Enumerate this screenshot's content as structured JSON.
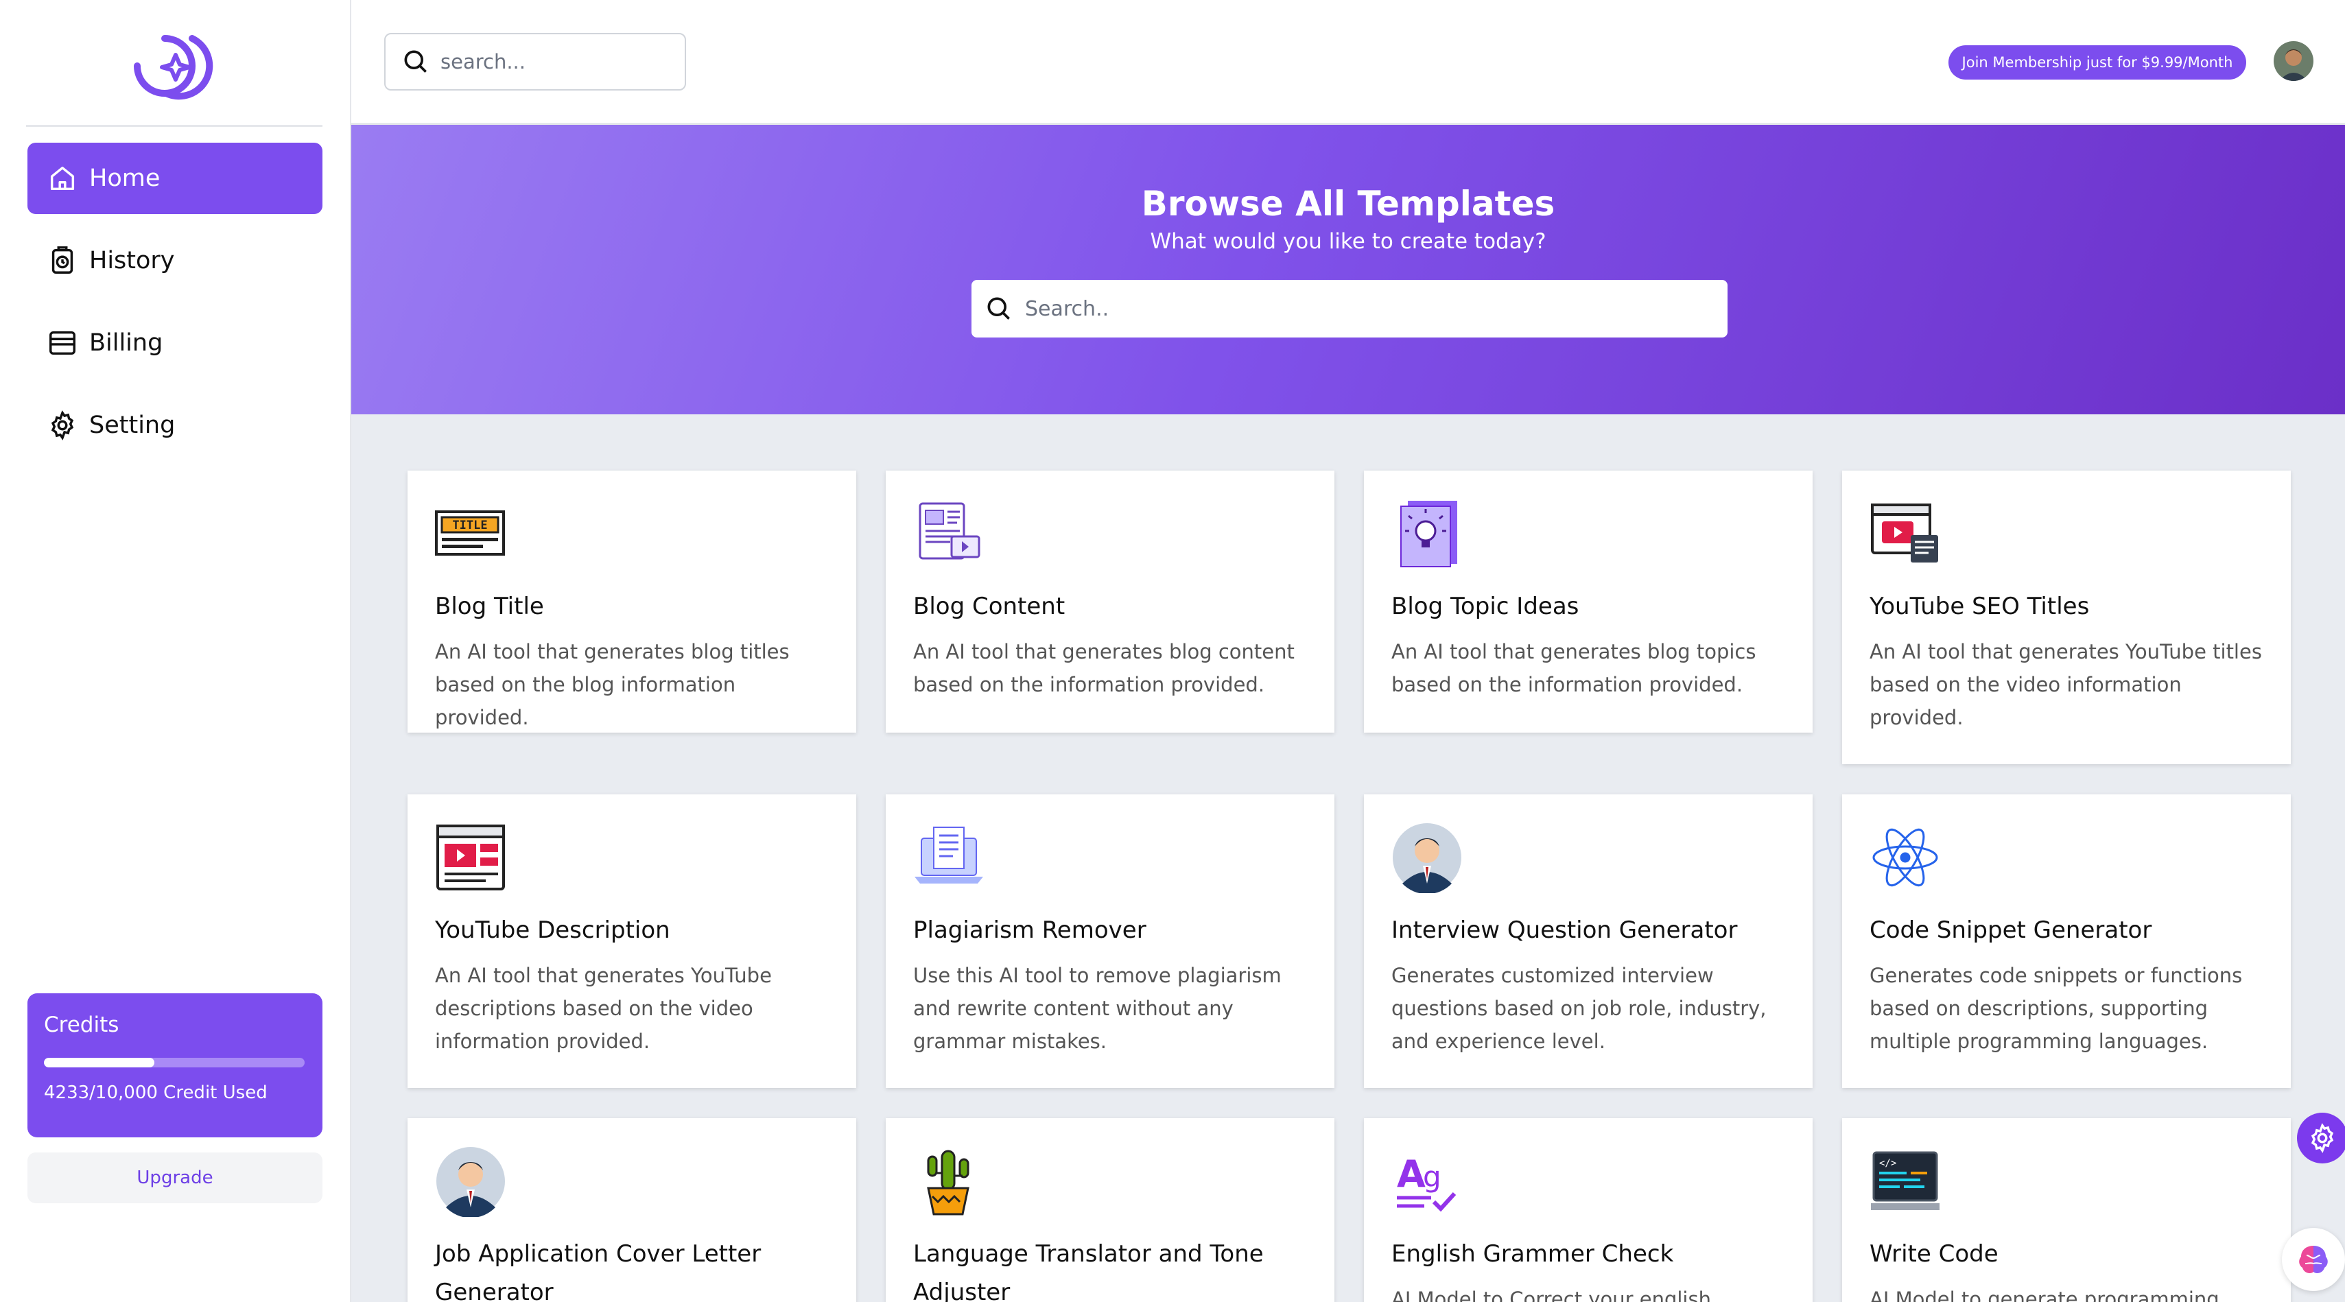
{
  "sidebar": {
    "items": [
      {
        "label": "Home",
        "icon": "home-icon",
        "active": true
      },
      {
        "label": "History",
        "icon": "history-icon",
        "active": false
      },
      {
        "label": "Billing",
        "icon": "billing-icon",
        "active": false
      },
      {
        "label": "Setting",
        "icon": "gear-icon",
        "active": false
      }
    ],
    "credits": {
      "title": "Credits",
      "used_text": "4233/10,000 Credit Used",
      "used": 4233,
      "total": 10000
    },
    "upgrade_label": "Upgrade"
  },
  "header": {
    "search_placeholder": "search...",
    "membership_label": "Join Membership just for $9.99/Month"
  },
  "hero": {
    "title": "Browse All Templates",
    "subtitle": "What would you like to create today?",
    "search_placeholder": "Search.."
  },
  "templates": [
    {
      "title": "Blog Title",
      "desc": "An AI tool that generates blog titles based on the blog information provided.",
      "icon": "title-icon"
    },
    {
      "title": "Blog Content",
      "desc": "An AI tool that generates blog content based on the information provided.",
      "icon": "content-icon"
    },
    {
      "title": "Blog Topic Ideas",
      "desc": "An AI tool that generates blog topics based on the information provided.",
      "icon": "idea-icon"
    },
    {
      "title": "YouTube SEO Titles",
      "desc": "An AI tool that generates YouTube titles based on the video information provided.",
      "icon": "video-seo-icon"
    },
    {
      "title": "YouTube Description",
      "desc": "An AI tool that generates YouTube descriptions based on the video information provided.",
      "icon": "video-description-icon"
    },
    {
      "title": "Plagiarism Remover",
      "desc": "Use this AI tool to remove plagiarism and rewrite content without any grammar mistakes.",
      "icon": "laptop-document-icon"
    },
    {
      "title": "Interview Question Generator",
      "desc": "Generates customized interview questions based on job role, industry, and experience level.",
      "icon": "businessman-icon"
    },
    {
      "title": "Code Snippet Generator",
      "desc": "Generates code snippets or functions based on descriptions, supporting multiple programming languages.",
      "icon": "atom-icon"
    },
    {
      "title": "Job Application Cover Letter Generator",
      "desc": "",
      "icon": "businessman-icon"
    },
    {
      "title": "Language Translator and Tone Adjuster",
      "desc": "",
      "icon": "cactus-icon"
    },
    {
      "title": "English Grammer Check",
      "desc": "AI Model to Correct your english",
      "icon": "grammar-icon"
    },
    {
      "title": "Write Code",
      "desc": "AI Model to generate programming",
      "icon": "code-monitor-icon"
    }
  ],
  "colors": {
    "accent": "#7c4dee",
    "hero_start": "#9a7cf2",
    "hero_end": "#6b2fc8",
    "background": "#e9ecf1"
  }
}
